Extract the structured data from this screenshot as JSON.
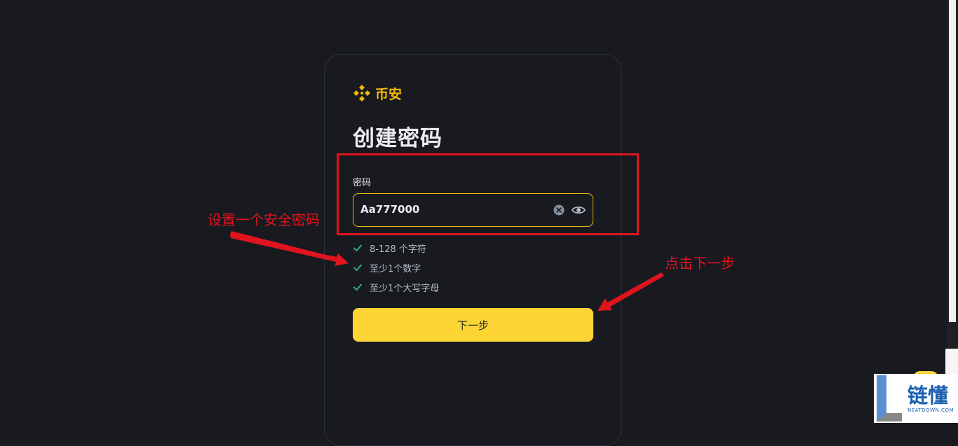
{
  "brand": {
    "logo_text": "币安",
    "accent_color": "#f0b90b"
  },
  "page": {
    "title": "创建密码"
  },
  "password_field": {
    "label": "密码",
    "value": "Aa777000",
    "clear_icon": "clear-circle-icon",
    "toggle_icon": "eye-icon"
  },
  "rules": [
    {
      "text": "8-128 个字符",
      "icon": "check-icon",
      "status": "passed"
    },
    {
      "text": "至少1个数字",
      "icon": "check-icon",
      "status": "passed"
    },
    {
      "text": "至少1个大写字母",
      "icon": "check-icon",
      "status": "passed"
    }
  ],
  "next_button": {
    "label": "下一步",
    "color": "#fcd535"
  },
  "annotations": {
    "password_tip": "设置一个安全密码",
    "next_tip": "点击下一步",
    "color": "#e0141e"
  },
  "watermark": {
    "cn": "链懂",
    "en": "NEATDOWN.COM"
  }
}
